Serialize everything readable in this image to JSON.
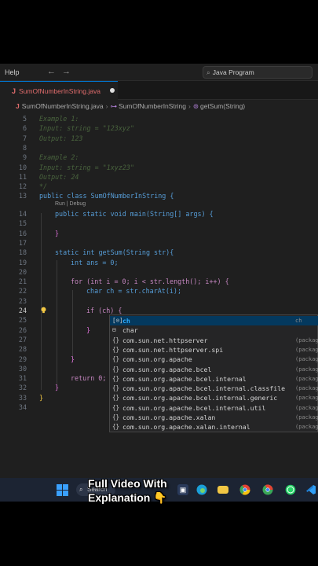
{
  "titlebar": {
    "menu_help": "Help",
    "nav_back": "←",
    "nav_forward": "→",
    "search_placeholder": "Java Program"
  },
  "tab": {
    "icon_letter": "J",
    "label": "SumOfNumberInString.java"
  },
  "breadcrumb": {
    "file": "SumOfNumberInString.java",
    "class": "SumOfNumberInString",
    "method": "getSum(String)"
  },
  "editor": {
    "codelens": "Run | Debug",
    "lines": [
      {
        "n": "5",
        "text": "Example 1:"
      },
      {
        "n": "6",
        "text": "Input: string = \"123xyz\""
      },
      {
        "n": "7",
        "text": "Output: 123"
      },
      {
        "n": "8",
        "text": ""
      },
      {
        "n": "9",
        "text": "Example 2:"
      },
      {
        "n": "10",
        "text": "Input: string = \"1xyz23\""
      },
      {
        "n": "11",
        "text": "Output: 24"
      },
      {
        "n": "12",
        "text": "*/"
      },
      {
        "n": "13",
        "text": "public class SumOfNumberInString {"
      },
      {
        "n": "14",
        "text": "public static void main(String[] args) {"
      },
      {
        "n": "15",
        "text": ""
      },
      {
        "n": "16",
        "text": "}"
      },
      {
        "n": "17",
        "text": ""
      },
      {
        "n": "18",
        "text": "static int getSum(String str){"
      },
      {
        "n": "19",
        "text": "int ans = 0;"
      },
      {
        "n": "20",
        "text": ""
      },
      {
        "n": "21",
        "text": "for (int i = 0; i < str.length(); i++) {"
      },
      {
        "n": "22",
        "text": "char ch = str.charAt(i);"
      },
      {
        "n": "23",
        "text": ""
      },
      {
        "n": "24",
        "text": "if (ch) {"
      },
      {
        "n": "25",
        "text": ""
      },
      {
        "n": "26",
        "text": "}"
      },
      {
        "n": "27",
        "text": ""
      },
      {
        "n": "28",
        "text": ""
      },
      {
        "n": "29",
        "text": "}"
      },
      {
        "n": "30",
        "text": ""
      },
      {
        "n": "31",
        "text": "return 0;"
      },
      {
        "n": "32",
        "text": "}"
      },
      {
        "n": "33",
        "text": "}"
      },
      {
        "n": "34",
        "text": ""
      }
    ]
  },
  "suggestions": [
    {
      "icon": "[⊙]",
      "label": "ch",
      "match": "ch",
      "detail": "ch"
    },
    {
      "icon": "⊟",
      "label": "char",
      "match": "ch",
      "detail": ""
    },
    {
      "icon": "{}",
      "label": "com.sun.net.httpserver",
      "match": "",
      "detail": "(package"
    },
    {
      "icon": "{}",
      "label": "com.sun.net.httpserver.spi",
      "match": "",
      "detail": "(package"
    },
    {
      "icon": "{}",
      "label": "com.sun.org.apache",
      "match": "",
      "detail": "(package"
    },
    {
      "icon": "{}",
      "label": "com.sun.org.apache.bcel",
      "match": "",
      "detail": "(package"
    },
    {
      "icon": "{}",
      "label": "com.sun.org.apache.bcel.internal",
      "match": "",
      "detail": "(package"
    },
    {
      "icon": "{}",
      "label": "com.sun.org.apache.bcel.internal.classfile",
      "match": "",
      "detail": "(package"
    },
    {
      "icon": "{}",
      "label": "com.sun.org.apache.bcel.internal.generic",
      "match": "",
      "detail": "(package"
    },
    {
      "icon": "{}",
      "label": "com.sun.org.apache.bcel.internal.util",
      "match": "",
      "detail": "(package"
    },
    {
      "icon": "{}",
      "label": "com.sun.org.apache.xalan",
      "match": "",
      "detail": "(package"
    },
    {
      "icon": "{}",
      "label": "com.sun.org.apache.xalan.internal",
      "match": "",
      "detail": "(package"
    }
  ],
  "taskbar": {
    "search_label": "Search",
    "icons": [
      "windows-icon",
      "widgets-icon",
      "edge-icon",
      "file-explorer-icon",
      "chrome-icon",
      "chrome-alt-icon",
      "whatsapp-icon",
      "vscode-icon"
    ]
  },
  "overlay": {
    "line1": "Full Video With",
    "line2": "Explanation",
    "emoji": "👇"
  },
  "colors": {
    "accent": "#0078d4",
    "editor_bg": "#1f1f1f",
    "keyword": "#569cd6",
    "type": "#4ec9b0",
    "function": "#dcdcaa",
    "comment": "#6a9955",
    "match_highlight": "#2aaaff"
  }
}
